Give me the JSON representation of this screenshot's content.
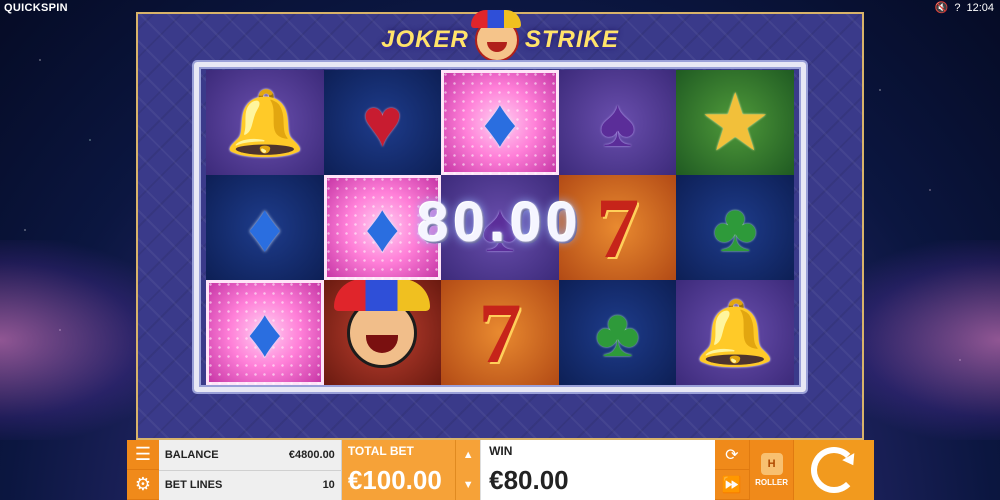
{
  "app": {
    "brand": "QUICKSPIN",
    "logo_left": "JOKER",
    "logo_right": "STRIKE"
  },
  "statusbar": {
    "mute_icon": "speaker-muted-icon",
    "help": "?",
    "clock": "12:04"
  },
  "reels": {
    "rows": [
      [
        {
          "symbol": "bell",
          "glyph": "🔔",
          "win": false,
          "bg": "purple"
        },
        {
          "symbol": "heart",
          "glyph": "♥",
          "win": false,
          "bg": "navy"
        },
        {
          "symbol": "diamond",
          "glyph": "♦",
          "win": true,
          "bg": "navy"
        },
        {
          "symbol": "spade",
          "glyph": "♠",
          "win": false,
          "bg": "purple"
        },
        {
          "symbol": "star",
          "glyph": "★",
          "win": false,
          "bg": "green"
        }
      ],
      [
        {
          "symbol": "diamond",
          "glyph": "♦",
          "win": false,
          "bg": "navy"
        },
        {
          "symbol": "diamond",
          "glyph": "♦",
          "win": true,
          "bg": "navy"
        },
        {
          "symbol": "spade",
          "glyph": "♠",
          "win": false,
          "bg": "purple"
        },
        {
          "symbol": "seven",
          "glyph": "7",
          "win": false,
          "bg": "orange"
        },
        {
          "symbol": "club",
          "glyph": "♣",
          "win": false,
          "bg": "navy"
        }
      ],
      [
        {
          "symbol": "diamond",
          "glyph": "♦",
          "win": true,
          "bg": "navy"
        },
        {
          "symbol": "joker",
          "glyph": "",
          "win": false,
          "bg": "joker"
        },
        {
          "symbol": "seven",
          "glyph": "7",
          "win": false,
          "bg": "orange"
        },
        {
          "symbol": "club",
          "glyph": "♣",
          "win": false,
          "bg": "navy"
        },
        {
          "symbol": "bell",
          "glyph": "🔔",
          "win": false,
          "bg": "purple"
        }
      ]
    ],
    "win_amount": "80.00"
  },
  "panel": {
    "balance_label": "BALANCE",
    "balance_value": "€4800.00",
    "betlines_label": "BET LINES",
    "betlines_value": "10",
    "totalbet_label": "TOTAL BET",
    "totalbet_value": "€100.00",
    "win_label": "WIN",
    "win_value": "€80.00",
    "roller_label": "ROLLER",
    "roller_badge": "H"
  },
  "colors": {
    "accent": "#f08a1a",
    "frame": "#3a3a8a",
    "gold": "#d8b36a"
  }
}
